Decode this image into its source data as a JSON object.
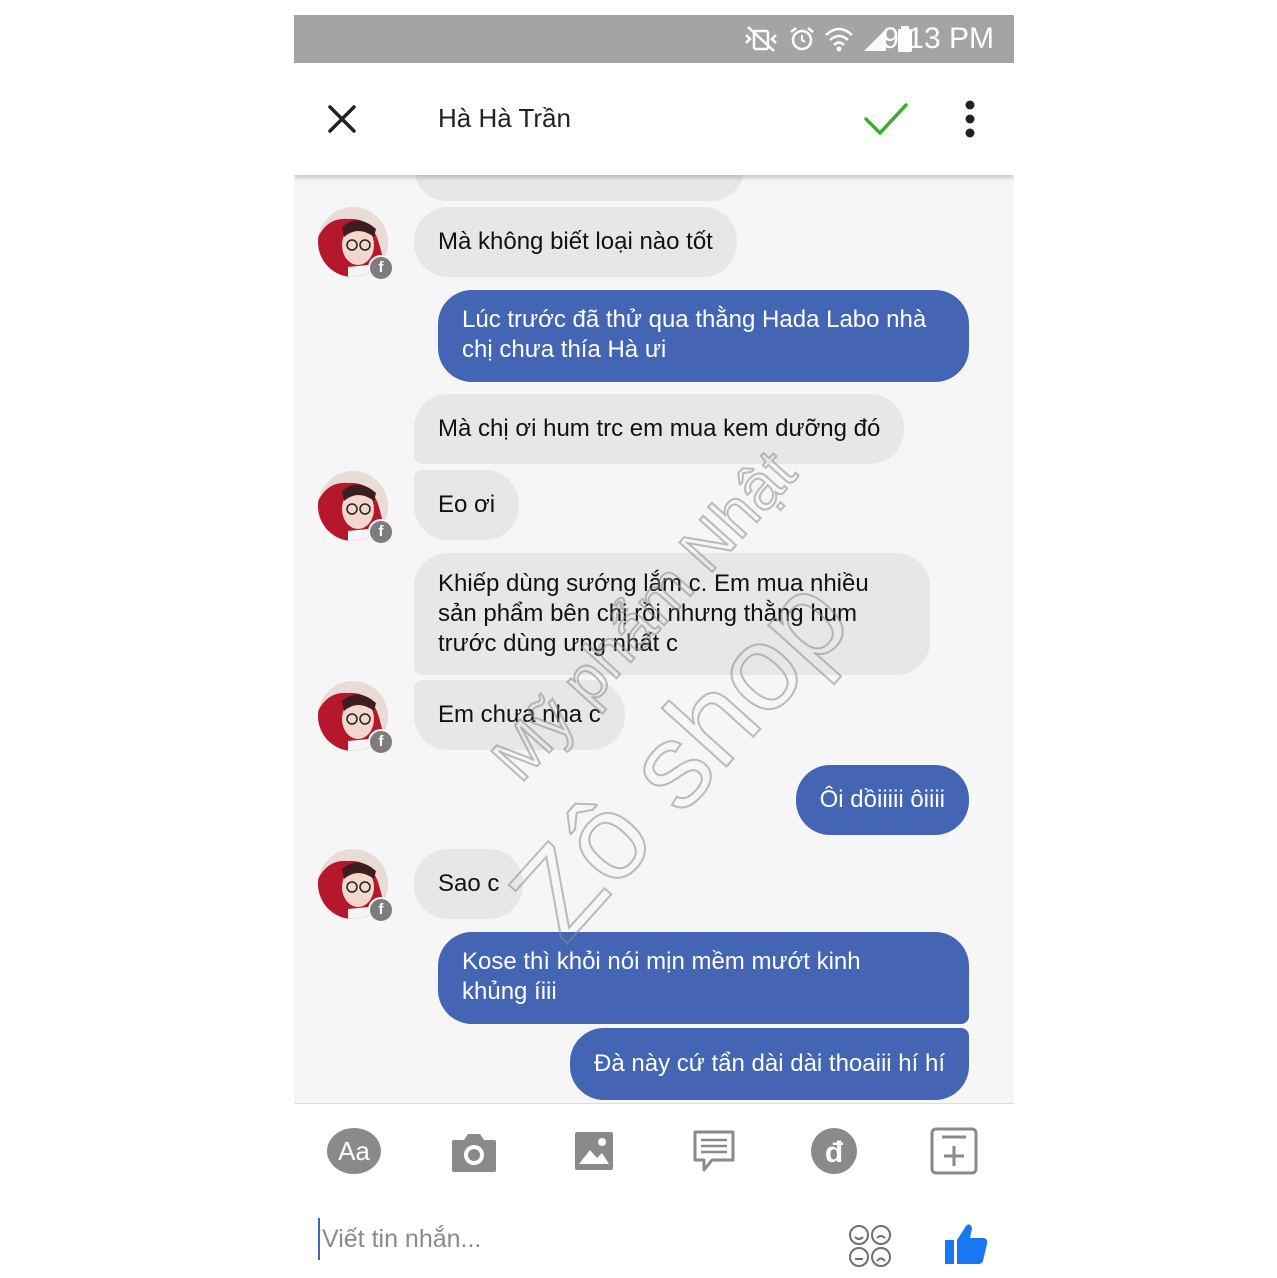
{
  "status_bar": {
    "time": "9:13 PM"
  },
  "header": {
    "contact_name": "Hà Hà Trần"
  },
  "messages": [
    {
      "from": "contact",
      "text": "Mà không biết loại nào tốt"
    },
    {
      "from": "me",
      "line1": "Lúc trước đã thử qua thằng Hada Labo nhà",
      "line2": "chị chưa thía Hà ưi"
    },
    {
      "from": "contact",
      "text": "Mà chị ơi hum trc em mua kem dưỡng đó"
    },
    {
      "from": "contact",
      "text": "Eo ơi"
    },
    {
      "from": "contact",
      "line1": "Khiếp dùng sướng lắm c. Em mua nhiều",
      "line2": "sản phẩm bên chị rồi nhưng thằng hum",
      "line3": "trước dùng ưng nhất c"
    },
    {
      "from": "contact",
      "text": "Em chưa nha c"
    },
    {
      "from": "me",
      "text": "Ôi dồiiiii ôiiii"
    },
    {
      "from": "contact",
      "text": "Sao c"
    },
    {
      "from": "me",
      "line1": "Kose thì khỏi nói mịn mềm mướt kinh",
      "line2": "khủng íiii"
    },
    {
      "from": "me",
      "text": "Đà này cứ tẩn dài dài thoaiii hí hí"
    }
  ],
  "watermark": {
    "line1": "Mỹ phẩm Nhật",
    "line2": "Zô shop"
  },
  "toolbar": {
    "text_button": "Aa",
    "payment_symbol": "đ"
  },
  "composer": {
    "placeholder": "Viết tin nhắn..."
  },
  "colors": {
    "outgoing_bubble": "#4365b3",
    "incoming_bubble": "#e7e7e7",
    "status_bar": "#a4a4a4",
    "check": "#3dae2b",
    "like": "#1877f2"
  }
}
